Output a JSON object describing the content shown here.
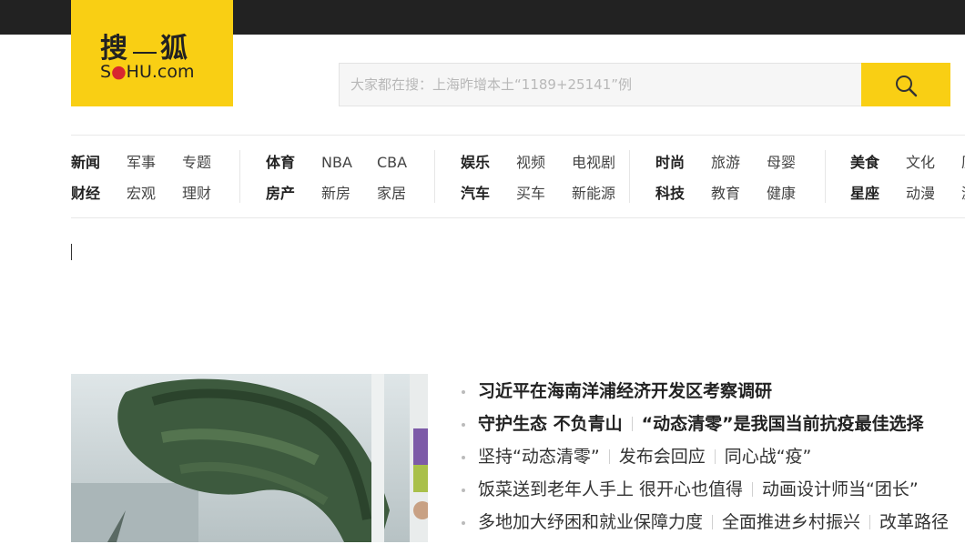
{
  "header": {
    "logo_cn_1": "搜",
    "logo_cn_2": "狐",
    "logo_en_pre": "S",
    "logo_en_mid": "HU.com",
    "brand_color": "#f9cf14",
    "topbar_color": "#222222"
  },
  "search": {
    "placeholder": "大家都在搜：上海昨增本土“1189+25141”例",
    "button_icon": "search-icon"
  },
  "nav": {
    "groups": [
      {
        "row1": [
          "新闻",
          "军事",
          "专题"
        ],
        "row2": [
          "财经",
          "宏观",
          "理财"
        ]
      },
      {
        "row1": [
          "体育",
          "NBA",
          "CBA"
        ],
        "row2": [
          "房产",
          "新房",
          "家居"
        ]
      },
      {
        "row1": [
          "娱乐",
          "视频",
          "电视剧"
        ],
        "row2": [
          "汽车",
          "买车",
          "新能源"
        ]
      },
      {
        "row1": [
          "时尚",
          "旅游",
          "母婴"
        ],
        "row2": [
          "科技",
          "教育",
          "健康"
        ]
      },
      {
        "row1": [
          "美食",
          "文化",
          "历"
        ],
        "row2": [
          "星座",
          "动漫",
          "游"
        ]
      }
    ]
  },
  "news": {
    "items": [
      {
        "parts": [
          "习近平在海南洋浦经济开发区考察调研"
        ],
        "strong": true
      },
      {
        "parts": [
          "守护生态 不负青山",
          "“动态清零”是我国当前抗疫最佳选择"
        ],
        "strong": true
      },
      {
        "parts": [
          "坚持“动态清零”",
          "发布会回应",
          "同心战“疫”"
        ],
        "strong": false
      },
      {
        "parts": [
          "饭菜送到老年人手上 很开心也值得",
          "动画设计师当“团长”"
        ],
        "strong": false
      },
      {
        "parts": [
          "多地加大纾困和就业保障力度",
          "全面推进乡村振兴",
          "改革路径"
        ],
        "strong": false
      }
    ]
  }
}
